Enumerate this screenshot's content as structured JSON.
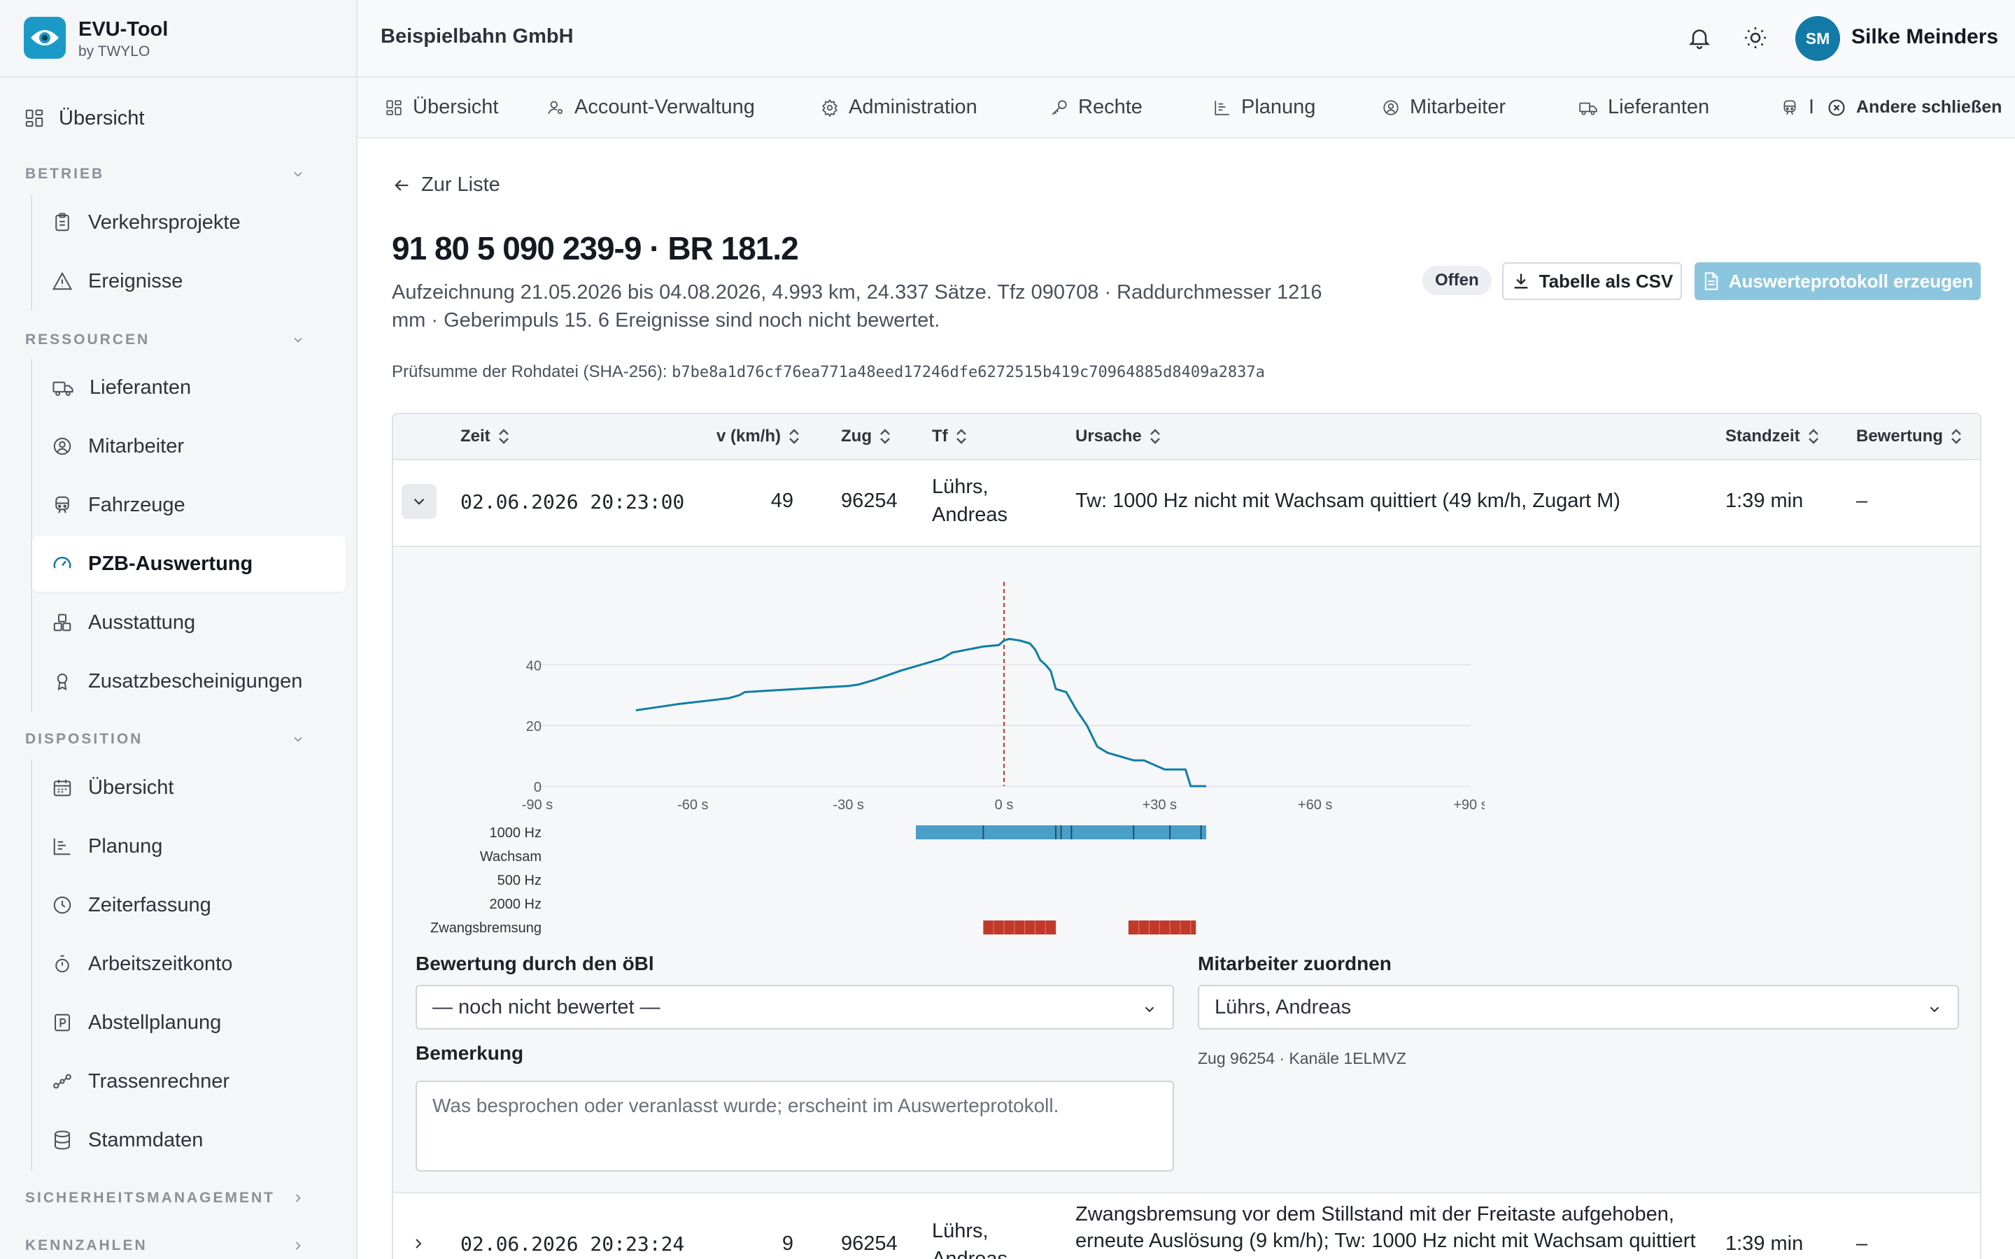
{
  "brand": {
    "name": "EVU-Tool",
    "sub": "by TWYLO"
  },
  "sidebar": {
    "top_item": "Übersicht",
    "sections": [
      {
        "label": "BETRIEB",
        "items": [
          "Verkehrsprojekte",
          "Ereignisse"
        ]
      },
      {
        "label": "RESSOURCEN",
        "items": [
          "Lieferanten",
          "Mitarbeiter",
          "Fahrzeuge",
          "PZB-Auswertung",
          "Ausstattung",
          "Zusatzbescheinigungen"
        ]
      },
      {
        "label": "DISPOSITION",
        "items": [
          "Übersicht",
          "Planung",
          "Zeiterfassung",
          "Arbeitszeitkonto",
          "Abstellplanung",
          "Trassenrechner",
          "Stammdaten"
        ]
      },
      {
        "label": "SICHERHEITSMANAGEMENT",
        "items": []
      },
      {
        "label": "KENNZAHLEN",
        "items": []
      }
    ],
    "active_item": "PZB-Auswertung"
  },
  "header": {
    "company": "Beispielbahn GmbH",
    "avatar_initials": "SM",
    "user_name": "Silke Meinders"
  },
  "tabs": [
    "Übersicht",
    "Account-Verwaltung",
    "Administration",
    "Rechte",
    "Planung",
    "Mitarbeiter",
    "Lieferanten",
    "I"
  ],
  "close_others": "Andere schließen",
  "page": {
    "back": "Zur Liste",
    "title": "91 80 5 090 239-9 · BR 181.2",
    "description": "Aufzeichnung 21.05.2026 bis 04.08.2026, 4.993 km, 24.337 Sätze. Tfz 090708 · Raddurchmesser 1216 mm · Geberimpuls 15. 6 Ereignisse sind noch nicht bewertet.",
    "status_badge": "Offen",
    "csv_button": "Tabelle als CSV",
    "protocol_button": "Auswerteprotokoll erzeugen",
    "checksum_label": "Prüfsumme der Rohdatei (SHA-256):",
    "checksum_value": "b7be8a1d76cf76ea771a48eed17246dfe6272515b419c70964885d8409a2837a"
  },
  "table": {
    "columns": [
      "Zeit",
      "v (km/h)",
      "Zug",
      "Tf",
      "Ursache",
      "Standzeit",
      "Bewertung"
    ],
    "rows": [
      {
        "time": "02.06.2026 20:23:00",
        "speed": "49",
        "train": "96254",
        "driver_line1": "Lührs,",
        "driver_line2": "Andreas",
        "cause_line1": "Tw: 1000 Hz nicht mit Wachsam quittiert (49 km/h, Zugart M)",
        "cause_line2": "",
        "standstill": "1:39 min",
        "rating": "–"
      },
      {
        "time": "02.06.2026 20:23:24",
        "speed": "9",
        "train": "96254",
        "driver_line1": "Lührs,",
        "driver_line2": "Andreas",
        "cause_line1": "Zwangsbremsung vor dem Stillstand mit der Freitaste aufgehoben,",
        "cause_line2": "erneute Auslösung (9 km/h); Tw: 1000 Hz nicht mit Wachsam quittiert",
        "standstill": "1:39 min",
        "rating": "–"
      }
    ]
  },
  "detail": {
    "rating_label": "Bewertung durch den öBl",
    "rating_value": "— noch nicht bewertet —",
    "employee_label": "Mitarbeiter zuordnen",
    "employee_value": "Lührs, Andreas",
    "remark_label": "Bemerkung",
    "remark_placeholder": "Was besprochen oder veranlasst wurde; erscheint im Auswerteprotokoll.",
    "train_info": "Zug 96254 · Kanäle 1ELMVZ"
  },
  "chart_data": {
    "type": "line",
    "xlim": [
      -90,
      90
    ],
    "ylim": [
      0,
      50
    ],
    "x_ticks": [
      "-90 s",
      "-60 s",
      "-30 s",
      "0 s",
      "+30 s",
      "+60 s",
      "+90 s"
    ],
    "y_ticks": [
      "0",
      "20",
      "40"
    ],
    "event_marker_x": 0,
    "colors": {
      "line": "#0e7ea6",
      "signal": "#4a9fc9",
      "brake": "#c0392b",
      "marker": "#c0392b"
    },
    "series": [
      {
        "x": [
          -71,
          -67,
          -63,
          -58,
          -53,
          -51,
          -50,
          -45,
          -40,
          -35,
          -30,
          -28,
          -25,
          -20,
          -17,
          -15,
          -12,
          -10,
          -7,
          -4,
          -1,
          0,
          1,
          3,
          5,
          6,
          7,
          8,
          9,
          10,
          11,
          12,
          13,
          14,
          16,
          18,
          19,
          20,
          22,
          24,
          25,
          26,
          27,
          29,
          31,
          32,
          33,
          34,
          35,
          36,
          37,
          39
        ],
        "y": [
          25,
          26,
          27,
          28,
          29,
          30,
          31,
          31.5,
          32,
          32.5,
          33,
          33.5,
          35,
          38,
          39.5,
          40.5,
          42,
          44,
          45,
          46,
          46.5,
          48,
          48.5,
          48,
          47,
          45,
          41.5,
          40,
          38,
          32,
          31.5,
          31,
          28,
          25,
          20,
          13,
          12,
          11,
          10,
          9,
          8.5,
          8.5,
          8.5,
          7,
          5.5,
          5.5,
          5.5,
          5.5,
          5.5,
          0,
          0,
          0
        ]
      }
    ],
    "tracks": [
      {
        "label": "1000 Hz",
        "intervals": [
          [
            -17,
            39
          ]
        ],
        "ticks": [
          -4,
          10,
          11,
          13,
          25,
          32,
          38
        ]
      },
      {
        "label": "Wachsam",
        "intervals": []
      },
      {
        "label": "500 Hz",
        "intervals": []
      },
      {
        "label": "2000 Hz",
        "intervals": []
      },
      {
        "label": "Zwangsbremsung",
        "intervals": [
          [
            -4,
            10
          ],
          [
            24,
            37
          ]
        ]
      }
    ]
  }
}
